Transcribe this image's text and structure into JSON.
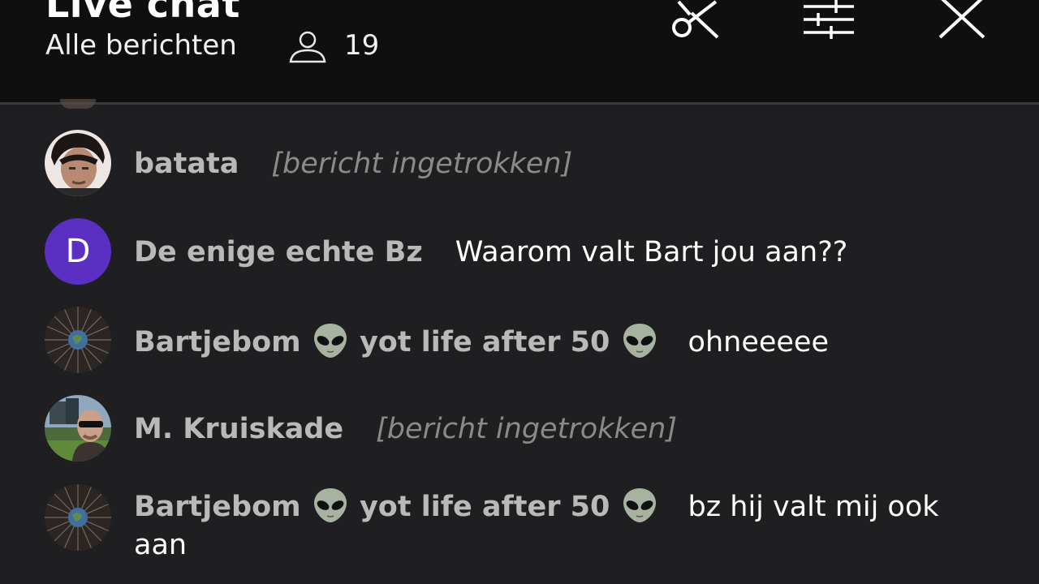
{
  "header": {
    "title": "Live chat",
    "subtitle": "Alle berichten",
    "viewer_count": "19",
    "icons": [
      "scissors-icon",
      "filter-sliders-icon",
      "close-icon"
    ]
  },
  "colors": {
    "background": "#1f1e21",
    "header_bg": "#0f0f0f",
    "author": "#b9b9b9",
    "message": "#ffffff",
    "retracted": "#8a8a8a",
    "avatar_d": "#5a2fc2"
  },
  "messages": [
    {
      "author": "batata",
      "text": "[bericht ingetrokken]",
      "retracted": true
    },
    {
      "author": "De enige echte Bz",
      "avatar_letter": "D",
      "text": "Waarom valt Bart jou aan??"
    },
    {
      "author_name": "Bartjebom",
      "author_suffix": "yot life after 50",
      "author_emoji": "alien-emoji",
      "text": "ohneeeee"
    },
    {
      "author": "M. Kruiskade",
      "text": "[bericht ingetrokken]",
      "retracted": true
    },
    {
      "author_name": "Bartjebom",
      "author_suffix": "yot life after 50",
      "author_emoji": "alien-emoji",
      "text": "bz hij valt mij ook",
      "text_cont": "aan"
    }
  ]
}
